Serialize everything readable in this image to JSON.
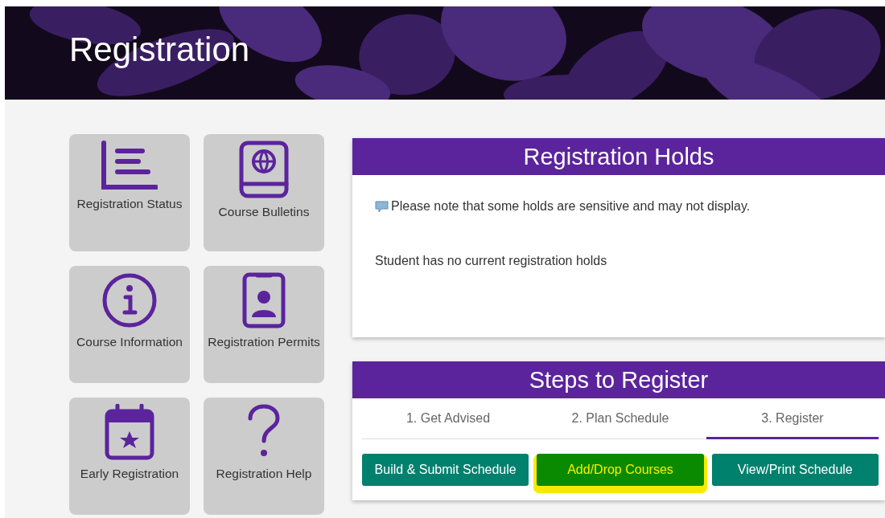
{
  "banner": {
    "title": "Registration"
  },
  "tiles": [
    {
      "label": "Registration Status"
    },
    {
      "label": "Course Bulletins"
    },
    {
      "label": "Course Information"
    },
    {
      "label": "Registration Permits"
    },
    {
      "label": "Early Registration"
    },
    {
      "label": "Registration Help"
    }
  ],
  "holds": {
    "title": "Registration Holds",
    "note": "Please note that some holds are sensitive and may not display.",
    "message": "Student has no current registration holds"
  },
  "steps": {
    "title": "Steps to Register",
    "tabs": [
      {
        "label": "1. Get Advised",
        "selected": false
      },
      {
        "label": "2. Plan Schedule",
        "selected": false
      },
      {
        "label": "3. Register",
        "selected": true
      }
    ],
    "buttons": [
      {
        "label": "Build & Submit Schedule",
        "highlighted": false
      },
      {
        "label": "Add/Drop Courses",
        "highlighted": true
      },
      {
        "label": "View/Print Schedule",
        "highlighted": false
      }
    ]
  }
}
